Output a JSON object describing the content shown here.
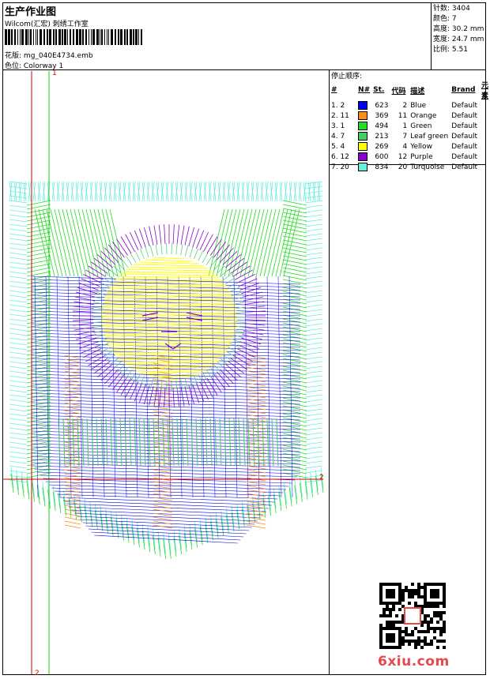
{
  "header": {
    "title": "生产作业图",
    "company": "Wilcom(汇宏) 刺绣工作室",
    "design_label": "花版:",
    "design_file": "mg_040E4734.emb",
    "colorway_label": "色位:",
    "colorway": "Colorway 1"
  },
  "stats": {
    "stitches_label": "针数:",
    "stitches": "3404",
    "colors_label": "颜色:",
    "colors": "7",
    "height_label": "高度:",
    "height": "30.2 mm",
    "width_label": "宽度:",
    "width": "24.7 mm",
    "scale_label": "比例:",
    "scale": "5.51"
  },
  "legend": {
    "title": "停止顺序:",
    "columns": [
      "#",
      "N#",
      "St.",
      "代码",
      "描述",
      "Brand",
      "元素"
    ],
    "rows": [
      {
        "order": "1. 2",
        "stitches": "623",
        "code": "2",
        "name": "Blue",
        "brand": "Default",
        "color": "#0000ee"
      },
      {
        "order": "2. 11",
        "stitches": "369",
        "code": "11",
        "name": "Orange",
        "brand": "Default",
        "color": "#ff8c1a"
      },
      {
        "order": "3. 1",
        "stitches": "494",
        "code": "1",
        "name": "Green",
        "brand": "Default",
        "color": "#22dd22"
      },
      {
        "order": "4. 7",
        "stitches": "213",
        "code": "7",
        "name": "Leaf green",
        "brand": "Default",
        "color": "#44cc66"
      },
      {
        "order": "5. 4",
        "stitches": "269",
        "code": "4",
        "name": "Yellow",
        "brand": "Default",
        "color": "#ffff00"
      },
      {
        "order": "6. 12",
        "stitches": "600",
        "code": "12",
        "name": "Purple",
        "brand": "Default",
        "color": "#8800cc"
      },
      {
        "order": "7. 20",
        "stitches": "834",
        "code": "20",
        "name": "Turquoise",
        "brand": "Default",
        "color": "#66eedd"
      }
    ]
  },
  "markers": {
    "top": "1",
    "bottom": "2",
    "right": "2"
  },
  "footer": {
    "logo": "6xiu.com"
  }
}
